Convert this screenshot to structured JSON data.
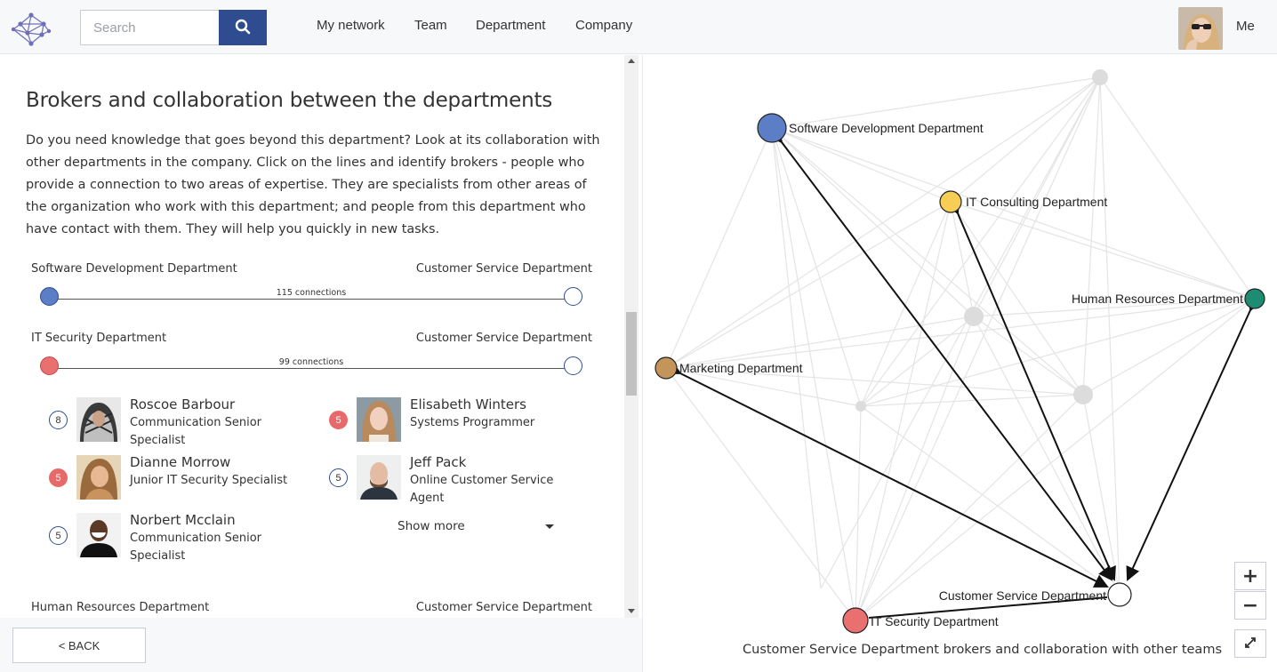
{
  "header": {
    "search_placeholder": "Search",
    "nav": [
      "My network",
      "Team",
      "Department",
      "Company"
    ],
    "me_label": "Me"
  },
  "main": {
    "title": "Brokers and collaboration between the departments",
    "description": "Do you need knowledge that goes beyond this department? Look at its collaboration with other departments in the company. Click on the lines and identify brokers - people who provide a connection to two areas of expertise. They are specialists from other areas of the organization who work with this department; and people from this department who have contact with them. They will help you quickly in new tasks.",
    "connections": [
      {
        "from": "Software Development Department",
        "to": "Customer Service Department",
        "count_label": "115 connections",
        "from_color": "#5b7ec6"
      },
      {
        "from": "IT Security Department",
        "to": "Customer Service Department",
        "count_label": "99 connections",
        "from_color": "#ea7070"
      },
      {
        "from": "Human Resources Department",
        "to": "Customer Service Department"
      }
    ],
    "people": [
      {
        "badge": "8",
        "badge_style": "plain",
        "name": "Roscoe Barbour",
        "role": "Communication Senior Specialist"
      },
      {
        "badge": "5",
        "badge_style": "red",
        "name": "Elisabeth Winters",
        "role": "Systems Programmer"
      },
      {
        "badge": "5",
        "badge_style": "red",
        "name": "Dianne Morrow",
        "role": "Junior IT Security Specialist"
      },
      {
        "badge": "5",
        "badge_style": "plain",
        "name": "Jeff Pack",
        "role": "Online Customer Service Agent"
      },
      {
        "badge": "5",
        "badge_style": "plain",
        "name": "Norbert Mcclain",
        "role": "Communication Senior Specialist"
      }
    ],
    "show_more": "Show more"
  },
  "footer": {
    "back_label": "< BACK"
  },
  "graph": {
    "caption": "Customer Service Department brokers and collaboration with other teams",
    "nodes": [
      {
        "label": "Software Development Department",
        "color": "#5b7ec6"
      },
      {
        "label": "IT Consulting Department",
        "color": "#f6cd55"
      },
      {
        "label": "Human Resources Department",
        "color": "#1e8c72"
      },
      {
        "label": "Marketing Department",
        "color": "#c4955a"
      },
      {
        "label": "Customer Service Department",
        "color": "#ffffff"
      },
      {
        "label": "IT Security Department",
        "color": "#ea7070"
      }
    ],
    "zoom_in": "+",
    "zoom_out": "−"
  }
}
